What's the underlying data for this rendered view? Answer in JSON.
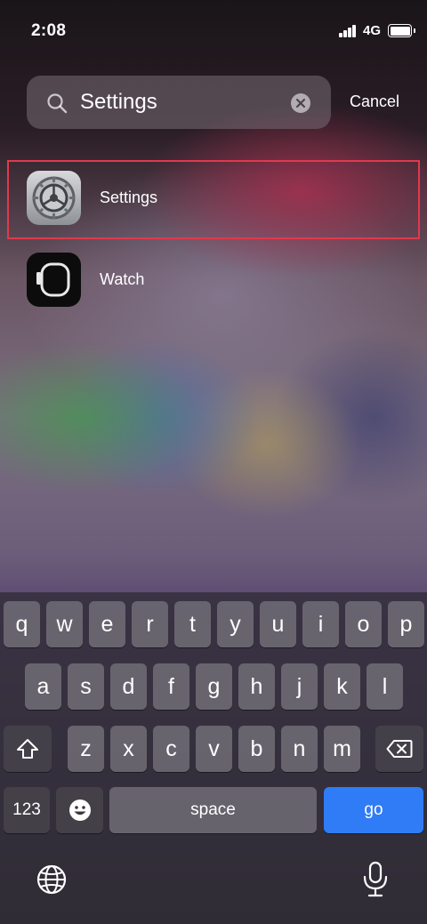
{
  "status_bar": {
    "time": "2:08",
    "network": "4G"
  },
  "search": {
    "query": "Settings",
    "cancel_label": "Cancel"
  },
  "results": [
    {
      "label": "Settings",
      "icon": "settings-gear-icon",
      "highlighted": true
    },
    {
      "label": "Watch",
      "icon": "apple-watch-icon",
      "highlighted": false
    }
  ],
  "keyboard": {
    "row1": [
      "q",
      "w",
      "e",
      "r",
      "t",
      "y",
      "u",
      "i",
      "o",
      "p"
    ],
    "row2": [
      "a",
      "s",
      "d",
      "f",
      "g",
      "h",
      "j",
      "k",
      "l"
    ],
    "row3": [
      "z",
      "x",
      "c",
      "v",
      "b",
      "n",
      "m"
    ],
    "numbers_label": "123",
    "space_label": "space",
    "go_label": "go"
  },
  "colors": {
    "highlight_border": "#e0394d",
    "go_key": "#2f7cf6"
  }
}
